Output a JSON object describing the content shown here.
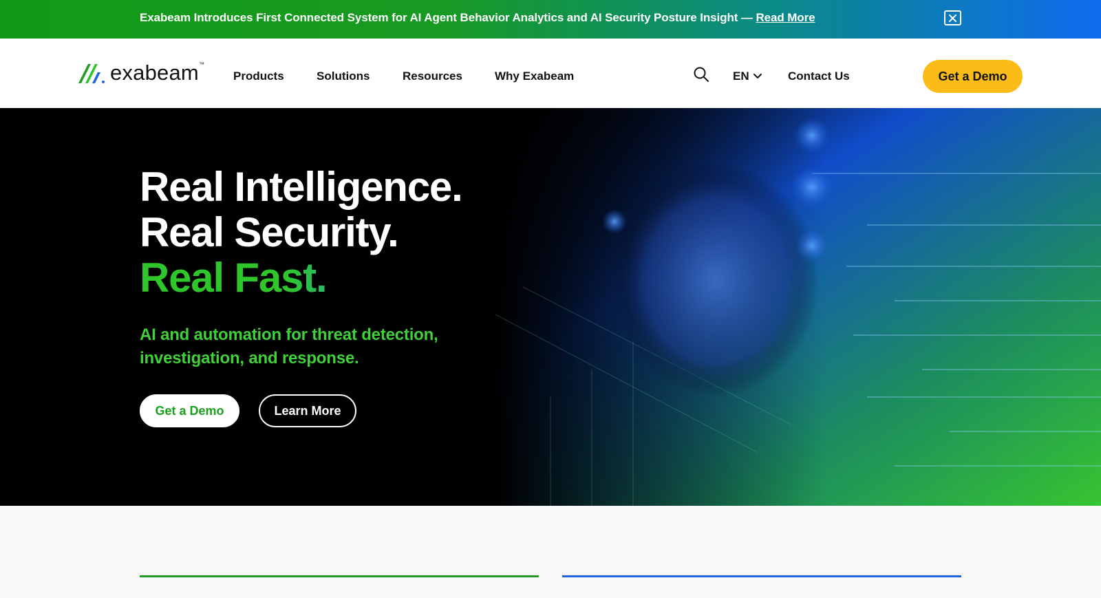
{
  "announcement": {
    "text": "Exabeam Introduces First Connected System for AI Agent Behavior Analytics and AI Security Posture Insight — ",
    "link": "Read More",
    "close_icon": "close-icon"
  },
  "header": {
    "logo_text": "exabeam",
    "logo_tm": "™",
    "nav": [
      "Products",
      "Solutions",
      "Resources",
      "Why Exabeam"
    ],
    "search_icon": "search-icon",
    "language": "EN",
    "contact": "Contact Us",
    "cta": "Get a Demo"
  },
  "hero": {
    "line1": "Real Intelligence.",
    "line2": "Real Security.",
    "line3": "Real Fast.",
    "subheading": "AI and automation for threat detection, investigation, and response.",
    "primary_button": "Get a Demo",
    "secondary_button": "Learn More"
  },
  "colors": {
    "accent_yellow": "#fcbc18",
    "brand_green": "#1f9c24",
    "brand_blue": "#1d63e0"
  }
}
